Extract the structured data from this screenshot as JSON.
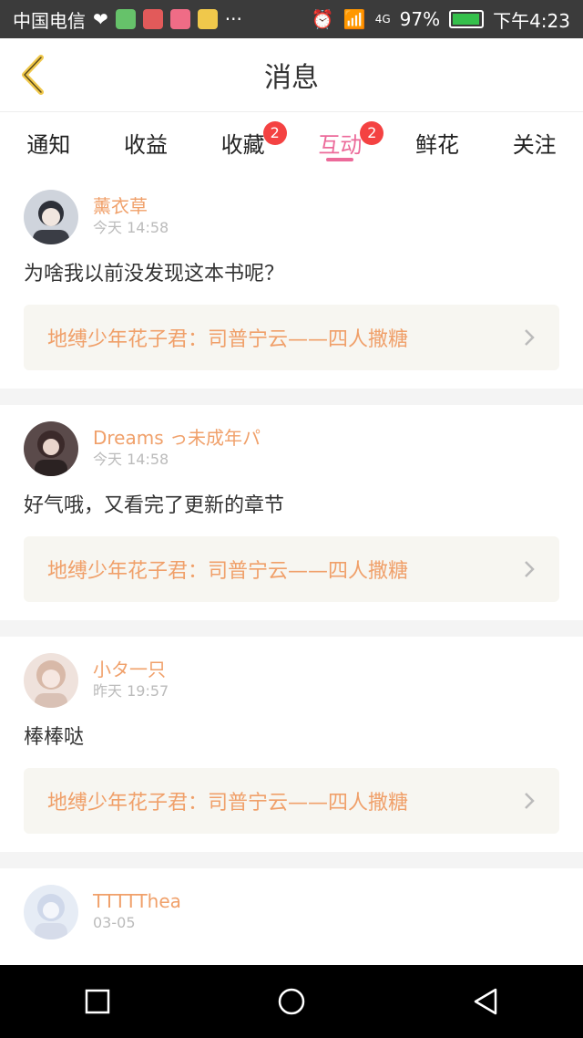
{
  "status_bar": {
    "carrier": "中国电信",
    "battery_percent": "97%",
    "time": "下午4:23",
    "signal": "4G"
  },
  "header": {
    "title": "消息"
  },
  "tabs": [
    {
      "label": "通知",
      "badge": ""
    },
    {
      "label": "收益",
      "badge": ""
    },
    {
      "label": "收藏",
      "badge": "2"
    },
    {
      "label": "互动",
      "badge": "2",
      "active": true
    },
    {
      "label": "鲜花",
      "badge": ""
    },
    {
      "label": "关注",
      "badge": ""
    }
  ],
  "feed": [
    {
      "name": "薰衣草",
      "time": "今天 14:58",
      "comment": "为啥我以前没发现这本书呢？",
      "book": "地缚少年花子君：司普宁云——四人撒糖"
    },
    {
      "name": "Dreams っ未成年パ",
      "time": "今天 14:58",
      "comment": "好气哦，又看完了更新的章节",
      "book": "地缚少年花子君：司普宁云——四人撒糖"
    },
    {
      "name": "小タ一只",
      "time": "昨天 19:57",
      "comment": "棒棒哒",
      "book": "地缚少年花子君：司普宁云——四人撒糖"
    },
    {
      "name": "TTTTThea",
      "time": "03-05",
      "comment": "",
      "book": ""
    }
  ],
  "colors": {
    "accent_pink": "#ec6a9a",
    "name_orange": "#f0a06a",
    "badge_red": "#f44242",
    "card_bg": "#f7f6f1"
  }
}
